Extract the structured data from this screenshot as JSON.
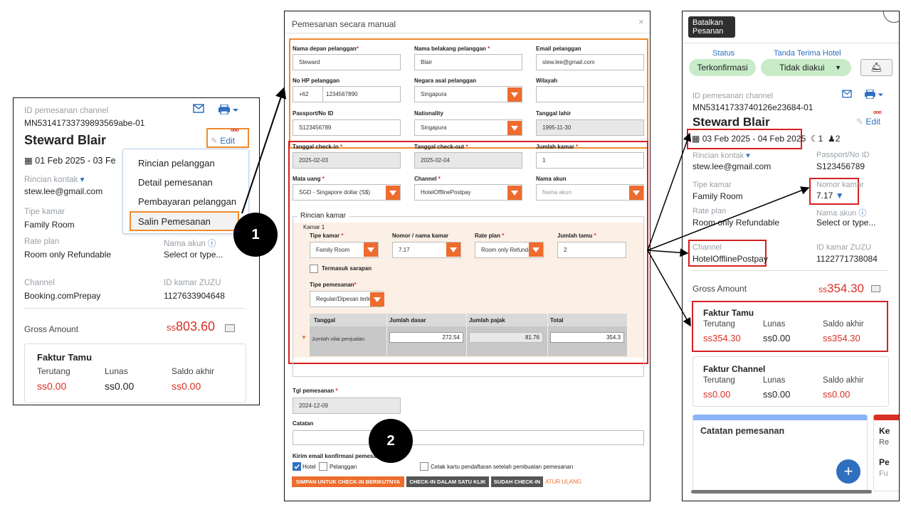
{
  "left": {
    "channel_id_label": "ID pemesanan channel",
    "channel_id": "MN53141733739893569abe-01",
    "guest_name": "Steward Blair",
    "edit_label": "Edit",
    "dots": "ooo",
    "date_range": "01 Feb 2025 - 03 Fe",
    "contact_label": "Rincian kontak",
    "contact": "stew.lee@gmail.com",
    "room_type_label": "Tipe kamar",
    "room_type": "Family Room",
    "rate_plan_label": "Rate plan",
    "rate_plan": "Room only Refundable",
    "account_label": "Nama akun",
    "account": "Select or type...",
    "channel_label": "Channel",
    "channel": "Booking.comPrepay",
    "zuzu_label": "ID kamar ZUZU",
    "zuzu": "1127633904648",
    "gross_label": "Gross Amount",
    "gross_currency": "ss",
    "gross_value": "803.60",
    "invoice_title": "Faktur Tamu",
    "col1": "Terutang",
    "col2": "Lunas",
    "col3": "Saldo akhir",
    "v1": "ss0.00",
    "v2": "ss0.00",
    "v3": "ss0.00",
    "menu": [
      "Rincian pelanggan",
      "Detail pemesanan",
      "Pembayaran pelanggan",
      "Salin Pemesanan"
    ]
  },
  "badges": {
    "one": "1",
    "two": "2"
  },
  "mid": {
    "title": "Pemesanan secara manual",
    "close": "×",
    "first_name_label": "Nama depan pelanggan",
    "first_name": "Steward",
    "last_name_label": "Nama belakang pelanggan",
    "last_name": "Blair",
    "email_label": "Email pelanggan",
    "email": "stew.lee@gmail.com",
    "phone_label": "No HP pelanggan",
    "phone_code": "+62",
    "phone": "1234567890",
    "country_label": "Negara asal pelanggan",
    "country": "Singapura",
    "region_label": "Wilayah",
    "region": "",
    "passport_label": "Passport/No ID",
    "passport": "S123456789",
    "nationality_label": "Nationality",
    "nationality": "Singapura",
    "dob_label": "Tanggal lahir",
    "dob": "1995-11-30",
    "checkin_label": "Tanggal check-in",
    "checkin": "2025-02-03",
    "checkout_label": "Tanggal check-out",
    "checkout": "2025-02-04",
    "rooms_label": "Jumlah kamar",
    "rooms": "1",
    "currency_label": "Mata uang",
    "currency": "SGD - Singapore dollar (S$)",
    "channel_label": "Channel",
    "channel": "HotelOfflinePostpay",
    "account_label": "Nama akun",
    "account_placeholder": "Nama akun",
    "room_section": "Rincian kamar",
    "room1": "Kamar 1",
    "rtype_label": "Tipe kamar",
    "rtype": "Family Room",
    "rnum_label": "Nomor / nama kamar",
    "rnum": "7.17",
    "rplan_label": "Rate plan",
    "rplan": "Room only Refunda",
    "guests_label": "Jumlah tamu",
    "guests": "2",
    "breakfast": "Termasuk sarapan",
    "btype_label": "Tipe pemesanan",
    "btype": "Regular/Dipesan terle",
    "th": [
      "Tanggal",
      "Jumlah dasar",
      "Jumlah pajak",
      "Total"
    ],
    "row_label": "Jumlah nilai penjualan",
    "base": "272.54",
    "tax": "81.76",
    "total": "354.3",
    "bdate_label": "Tgl pemesanan",
    "bdate": "2024-12-09",
    "notes_label": "Catatan",
    "email_confirm_label": "Kirim email konfirmasi pemesa",
    "hotel": "Hotel",
    "guest": "Pelanggan",
    "print_card": "Cetak kartu pendaftaran setelah pembuatan pemesanan",
    "btn_save": "SIMPAN UNTUK CHECK-IN BERIKUTNYA",
    "btn_checkin": "CHECK-IN DALAM SATU KLIK",
    "btn_done": "SUDAH CHECK-IN",
    "reset": "ATUR ULANG"
  },
  "right": {
    "cancel": "Batalkan Pesanan",
    "status_label": "Status",
    "status": "Terkonfirmasi",
    "receipt_label": "Tanda Terima Hotel",
    "receipt": "Tidak diakui",
    "channel_id_label": "ID pemesanan channel",
    "channel_id": "MN53141733740126e23684-01",
    "guest_name": "Steward Blair",
    "edit_label": "Edit",
    "dots": "ooo",
    "date_range": "03 Feb 2025 - 04 Feb 2025",
    "nights": "1",
    "guests": "2",
    "contact_label": "Rincian kontak",
    "contact": "stew.lee@gmail.com",
    "passport_label": "Passport/No ID",
    "passport": "S123456789",
    "room_type_label": "Tipe kamar",
    "room_type": "Family Room",
    "room_no_label": "Nomor kamar",
    "room_no": "7.17",
    "rate_plan_label": "Rate plan",
    "rate_plan": "Room only Refundable",
    "account_label": "Nama akun",
    "account": "Select or type...",
    "channel_label": "Channel",
    "channel": "HotelOfflinePostpay",
    "zuzu_label": "ID kamar ZUZU",
    "zuzu": "1122771738084",
    "gross_label": "Gross Amount",
    "gross_currency": "ss",
    "gross_value": "354.30",
    "inv1_title": "Faktur Tamu",
    "col1": "Terutang",
    "col2": "Lunas",
    "col3": "Saldo akhir",
    "inv1_v1": "ss354.30",
    "inv1_v2": "ss0.00",
    "inv1_v3": "ss354.30",
    "inv2_title": "Faktur Channel",
    "inv2_v1": "ss0.00",
    "inv2_v2": "ss0.00",
    "inv2_v3": "ss0.00",
    "notes_title": "Catatan pemesanan",
    "side_k": "Ke",
    "side_re": "Re",
    "side_pe": "Pe",
    "side_fu": "Fu",
    "fab": "+"
  },
  "colors": {
    "accent": "#2e6fc0",
    "red": "#d93025",
    "orange": "#ee6c2d",
    "green": "#c8ecc8"
  }
}
